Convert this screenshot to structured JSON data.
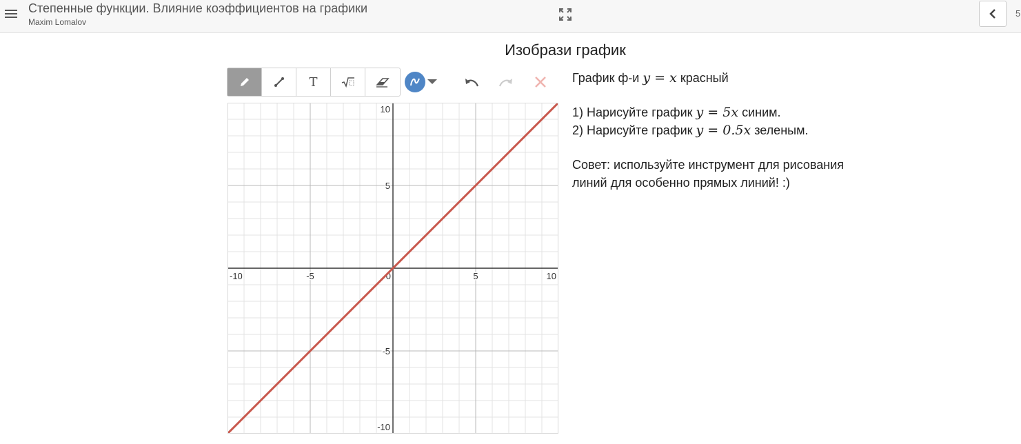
{
  "header": {
    "title": "Степенные функции. Влияние коэффициентов на графики",
    "author": "Maxim Lomalov",
    "page_indicator": "5"
  },
  "task": {
    "heading": "Изобрази график"
  },
  "toolbar": {
    "tools": [
      "pencil-icon",
      "line-icon",
      "text-tool-icon",
      "sqrt-icon",
      "eraser-icon"
    ],
    "text_tool_glyph": "T",
    "active_tool": "pencil",
    "current_color": "#4f86c6"
  },
  "graph": {
    "xlim": [
      -10,
      10
    ],
    "ylim": [
      -10,
      10
    ],
    "x_ticks": [
      "-10",
      "-5",
      "0",
      "5",
      "10"
    ],
    "y_ticks": [
      "10",
      "5",
      "-5",
      "-10"
    ],
    "minor_grid_step": 1,
    "major_grid_step": 5,
    "lines": [
      {
        "label": "y = x",
        "color": "#c8584d",
        "x": [
          -10,
          10
        ],
        "y": [
          -10,
          10
        ]
      }
    ]
  },
  "instructions": {
    "line1_prefix": "График ф-и",
    "line1_math": "y = x",
    "line1_suffix": "красный",
    "step1_prefix": "1) Нарисуйте график",
    "step1_math": "y = 5x",
    "step1_suffix": "синим.",
    "step2_prefix": "2) Нарисуйте график",
    "step2_math": "y = 0.5x",
    "step2_suffix": "зеленым.",
    "tip": "Совет: используйте инструмент для рисования линий для особенно прямых линий! :)"
  }
}
